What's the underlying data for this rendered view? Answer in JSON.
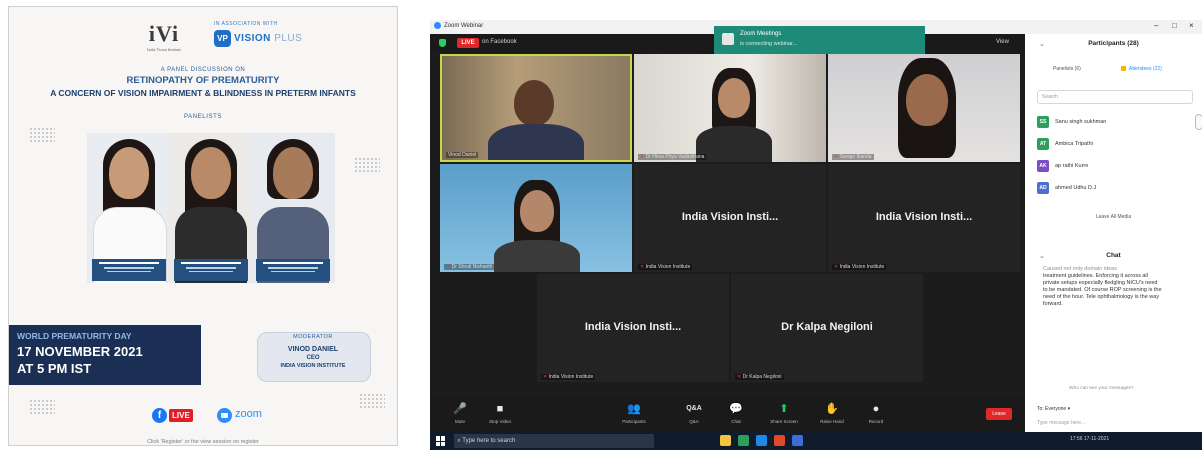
{
  "poster": {
    "ivi_logo": "iVi",
    "ivi_tagline": "India Vision Institute",
    "assoc_label": "IN ASSOCIATION WITH",
    "partner_badge": "VP",
    "partner_name": "VISION",
    "partner_suffix": "PLUS",
    "panel_intro": "A PANEL DISCUSSION ON",
    "title": "RETINOPATHY OF PREMATURITY",
    "subtitle": "A CONCERN OF VISION IMPAIRMENT & BLINDNESS IN PRETERM INFANTS",
    "panelists_label": "PANELISTS",
    "event_name": "WORLD PREMATURITY DAY",
    "event_date": "17 NOVEMBER 2021",
    "event_time": "AT 5 PM IST",
    "moderator_label": "MODERATOR",
    "moderator_name": "VINOD DANIEL",
    "moderator_role": "CEO",
    "moderator_org": "INDIA VISION INSTITUTE",
    "fb_glyph": "f",
    "live_label": "LIVE",
    "zoom_label": "zoom",
    "footer": "Click 'Register' or the view session on register"
  },
  "zoom": {
    "window_title": "Zoom Webinar",
    "live_label": "LIVE",
    "on_platform": "on Facebook",
    "notification_title": "Zoom Meetings",
    "notification_body": "is connecting webinar...",
    "view_label": "View",
    "tiles": [
      {
        "name": "Vinod Daniel",
        "big": ""
      },
      {
        "name": "Dr Hima Priya Vadasthana",
        "big": ""
      },
      {
        "name": "Sanigo Ikanda",
        "big": ""
      },
      {
        "name": "Dr Shruti Nishanth",
        "big": ""
      },
      {
        "name": "India Vision Institute",
        "big": "India Vision Insti..."
      },
      {
        "name": "India Vision Institute",
        "big": "India Vision Insti..."
      },
      {
        "name": "India Vision Institute",
        "big": "India Vision Insti..."
      },
      {
        "name": "Dr Kalpa Negiloni",
        "big": "Dr Kalpa Negiloni"
      }
    ],
    "toolbar": [
      {
        "icon": "🎤",
        "label": "Mute"
      },
      {
        "icon": "■",
        "label": "Stop Video"
      },
      {
        "icon": "👥",
        "label": "Participants"
      },
      {
        "icon": "Q&A",
        "label": "Q&A"
      },
      {
        "icon": "💬",
        "label": "Chat"
      },
      {
        "icon": "⬆",
        "label": "Share Screen"
      },
      {
        "icon": "✋",
        "label": "Raise Hand"
      },
      {
        "icon": "●",
        "label": "Record"
      }
    ],
    "end_label": "Leave",
    "search_placeholder": "Type here to search",
    "tray_time": "17:56",
    "tray_date": "17-11-2021"
  },
  "side": {
    "participants_title": "Participants (28)",
    "tab_panelists": "Panelists (6)",
    "tab_attendees": "Attendees (22)",
    "search_placeholder": "Search",
    "participants": [
      {
        "initials": "SS",
        "name": "Sanu singh sukhman",
        "color": "#2e9e5b"
      },
      {
        "initials": "AT",
        "name": "Ambica Tripathi",
        "color": "#2e9e5b"
      },
      {
        "initials": "AK",
        "name": "ap rathi Kurre",
        "color": "#7b4fc4"
      },
      {
        "initials": "AD",
        "name": "ahmed Udhu D.J",
        "color": "#4f6fd0"
      }
    ],
    "leave_all": "Leave All Media",
    "chat_title": "Chat",
    "chat_from": "Caused not only domain ideas",
    "chat_message": "treatment guidelines. Enforcing it across all private setups especially fledgling NICU's need to be mandated. Of course ROP screening is the need of the hour. Tele ophthalmology is the way forward.",
    "chat_hint": "Who can see your messages?",
    "to_label": "To: Everyone ▾",
    "input_placeholder": "Type message here..."
  },
  "colors": {
    "poster_navy": "#1b2f55",
    "poster_blue": "#2a5d96",
    "zoom_dark": "#1c1c1c",
    "notification_teal": "#1e8a78",
    "live_red": "#e02828"
  }
}
